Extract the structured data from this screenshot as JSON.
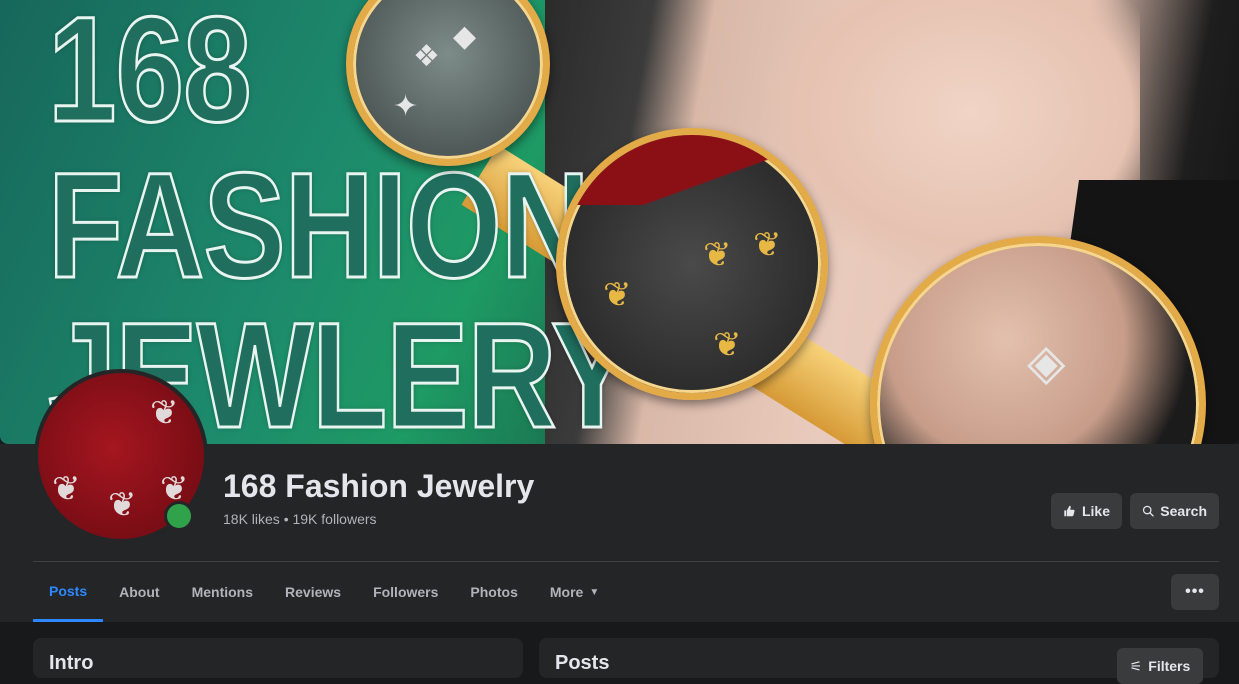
{
  "cover": {
    "line1": "168",
    "line2": "FASHION",
    "line3": "JEWLERY"
  },
  "page": {
    "name": "168 Fashion Jewelry",
    "stats": "18K likes • 19K followers"
  },
  "actions": {
    "like_label": "Like",
    "search_label": "Search",
    "more_options_label": "•••"
  },
  "tabs": [
    {
      "label": "Posts",
      "active": true
    },
    {
      "label": "About"
    },
    {
      "label": "Mentions"
    },
    {
      "label": "Reviews"
    },
    {
      "label": "Followers"
    },
    {
      "label": "Photos"
    },
    {
      "label": "More"
    }
  ],
  "intro": {
    "title": "Intro"
  },
  "posts": {
    "title": "Posts",
    "filters_label": "Filters"
  },
  "colors": {
    "accent": "#2d88ff",
    "online": "#31a24c",
    "surface": "#242526",
    "background": "#18191a"
  }
}
